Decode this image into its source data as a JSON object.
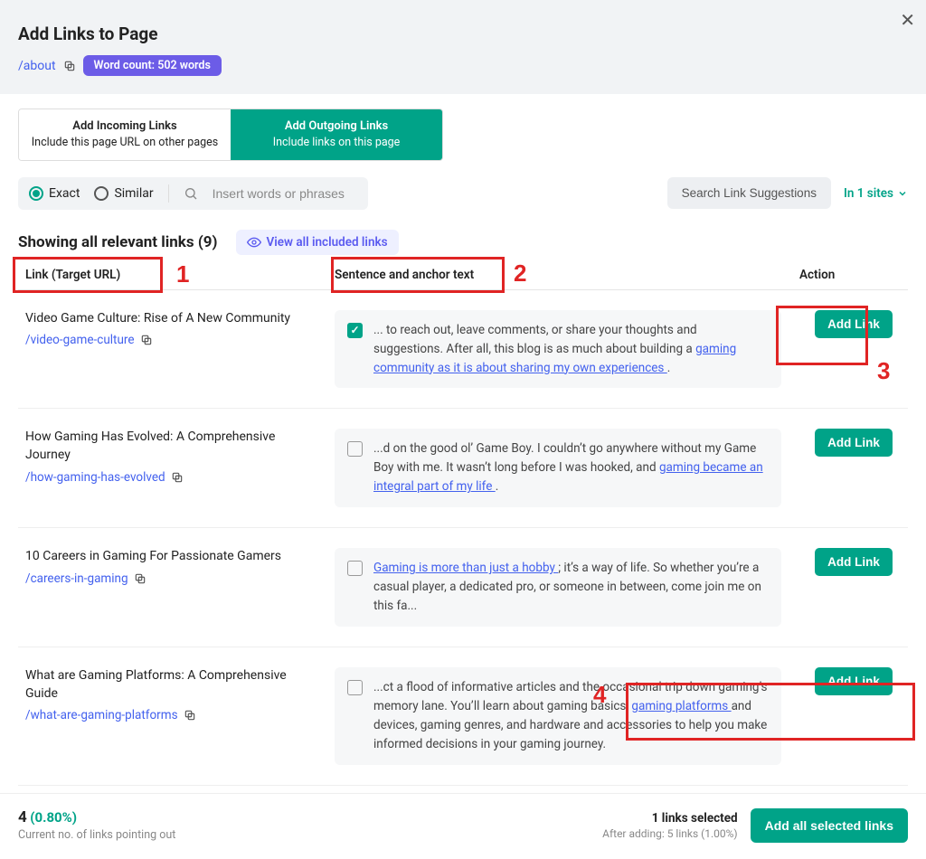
{
  "header": {
    "title": "Add Links to Page",
    "path": "/about",
    "word_count_badge": "Word count: 502 words"
  },
  "tabs": {
    "incoming": {
      "line1": "Add Incoming Links",
      "line2": "Include this page URL on other pages"
    },
    "outgoing": {
      "line1": "Add Outgoing Links",
      "line2": "Include links on this page"
    }
  },
  "search": {
    "mode_exact": "Exact",
    "mode_similar": "Similar",
    "placeholder": "Insert words or phrases",
    "suggestions_btn": "Search Link Suggestions",
    "sites_label": "In 1 sites"
  },
  "results": {
    "heading": "Showing all relevant links (9)",
    "view_all": "View all included links",
    "col_link": "Link (Target URL)",
    "col_sentence": "Sentence and anchor text",
    "col_action": "Action"
  },
  "rows": [
    {
      "title": "Video Game Culture: Rise of A New Community",
      "url": "/video-game-culture",
      "checked": true,
      "pre": "... to reach out, leave comments, or share your thoughts and suggestions. After all, this blog is as much about building a ",
      "anchor": "gaming community as it is about sharing my own experiences ",
      "post": ".",
      "action": "Add Link"
    },
    {
      "title": "How Gaming Has Evolved: A Comprehensive Journey",
      "url": "/how-gaming-has-evolved",
      "checked": false,
      "pre": "...d on the good ol’ Game Boy. I couldn’t go anywhere without my Game Boy with me. It wasn’t long before I was hooked, and ",
      "anchor": "gaming became an integral part of my life ",
      "post": ".",
      "action": "Add Link"
    },
    {
      "title": "10 Careers in Gaming For Passionate Gamers",
      "url": "/careers-in-gaming",
      "checked": false,
      "pre": "",
      "anchor": "Gaming is more than just a hobby ",
      "post": "; it’s a way of life. So whether you’re a casual player, a dedicated pro, or someone in between, come join me on this fa...",
      "action": "Add Link"
    },
    {
      "title": "What are Gaming Platforms: A Comprehensive Guide",
      "url": "/what-are-gaming-platforms",
      "checked": false,
      "pre": "...ct a flood of informative articles and the occasional trip down gaming’s memory lane. You’ll learn about gaming basics, ",
      "anchor": "gaming platforms ",
      "post": "and devices, gaming genres, and hardware and accessories to help you make informed decisions in your gaming journey.",
      "action": "Add Link"
    }
  ],
  "footer": {
    "count": "4",
    "pct": "(0.80%)",
    "subtitle": "Current no. of links pointing out",
    "selected_line": "1 links selected",
    "after_line": "After adding: 5 links (1.00%)",
    "add_all": "Add all selected links"
  },
  "annotations": {
    "n1": "1",
    "n2": "2",
    "n3": "3",
    "n4": "4"
  }
}
